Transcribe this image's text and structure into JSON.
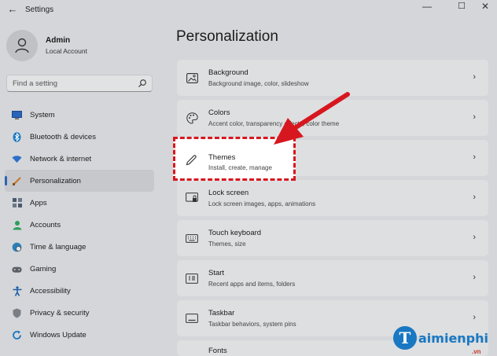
{
  "window": {
    "title": "Settings",
    "back_icon": "back-arrow-icon",
    "min": "—",
    "max": "☐",
    "close": "✕"
  },
  "profile": {
    "name": "Admin",
    "subtitle": "Local Account"
  },
  "search": {
    "placeholder": "Find a setting"
  },
  "nav": {
    "items": [
      {
        "label": "System",
        "icon": "monitor-icon",
        "color": "#2b63b8"
      },
      {
        "label": "Bluetooth & devices",
        "icon": "bluetooth-icon",
        "color": "#1a78c2"
      },
      {
        "label": "Network & internet",
        "icon": "wifi-icon",
        "color": "#2e6fc9"
      },
      {
        "label": "Personalization",
        "icon": "brush-icon",
        "color": "#c9772a",
        "active": true
      },
      {
        "label": "Apps",
        "icon": "apps-icon",
        "color": "#4b5a6b"
      },
      {
        "label": "Accounts",
        "icon": "person-icon",
        "color": "#2e9e5b"
      },
      {
        "label": "Time & language",
        "icon": "globe-clock-icon",
        "color": "#2a7fb8"
      },
      {
        "label": "Gaming",
        "icon": "gamepad-icon",
        "color": "#555"
      },
      {
        "label": "Accessibility",
        "icon": "accessibility-icon",
        "color": "#1d5fa8"
      },
      {
        "label": "Privacy & security",
        "icon": "shield-icon",
        "color": "#7a7f86"
      },
      {
        "label": "Windows Update",
        "icon": "update-icon",
        "color": "#1a78c2"
      }
    ]
  },
  "main": {
    "title": "Personalization",
    "cards": [
      {
        "title": "Background",
        "subtitle": "Background image, color, slideshow",
        "icon": "image-icon"
      },
      {
        "title": "Colors",
        "subtitle": "Accent color, transparency effects, color theme",
        "icon": "palette-icon"
      },
      {
        "title": "Themes",
        "subtitle": "Install, create, manage",
        "icon": "pen-icon"
      },
      {
        "title": "Lock screen",
        "subtitle": "Lock screen images, apps, animations",
        "icon": "lock-screen-icon"
      },
      {
        "title": "Touch keyboard",
        "subtitle": "Themes, size",
        "icon": "keyboard-icon"
      },
      {
        "title": "Start",
        "subtitle": "Recent apps and items, folders",
        "icon": "start-icon"
      },
      {
        "title": "Taskbar",
        "subtitle": "Taskbar behaviors, system pins",
        "icon": "taskbar-icon"
      },
      {
        "title": "Fonts",
        "subtitle": "",
        "icon": "fonts-icon"
      }
    ]
  },
  "annotation": {
    "highlight_color": "#d7171f"
  },
  "watermark": {
    "logo_letter": "T",
    "text": "aimienphi",
    "suffix": ".vn"
  }
}
